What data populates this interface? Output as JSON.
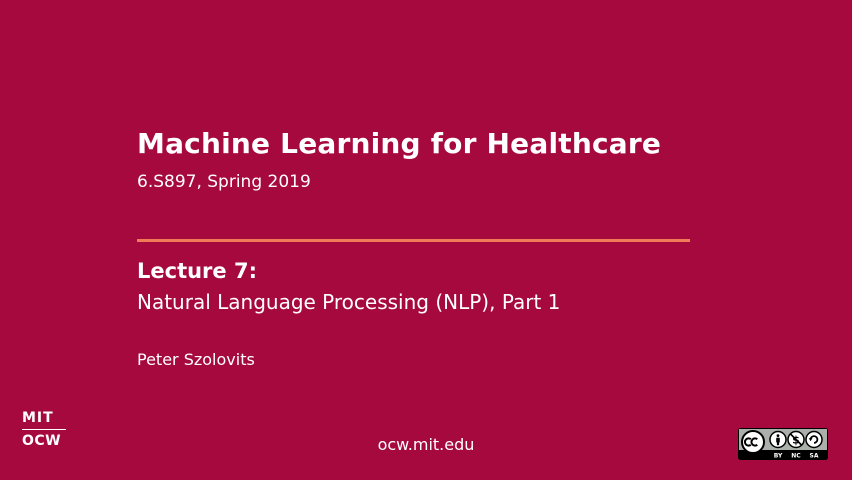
{
  "slide": {
    "course_title": "Machine Learning for Healthcare",
    "course_subtitle": "6.S897, Spring 2019",
    "lecture_number": "Lecture 7:",
    "lecture_title": "Natural Language Processing (NLP), Part 1",
    "presenter": "Peter Szolovits",
    "footer_url": "ocw.mit.edu"
  },
  "logo": {
    "line1": "MIT",
    "line2": "OCW"
  },
  "license": {
    "labels": [
      "BY",
      "NC",
      "SA"
    ],
    "icon": "creative-commons-by-nc-sa-icon"
  },
  "colors": {
    "background": "#a6093d",
    "divider": "#f07c57",
    "text": "#ffffff"
  }
}
